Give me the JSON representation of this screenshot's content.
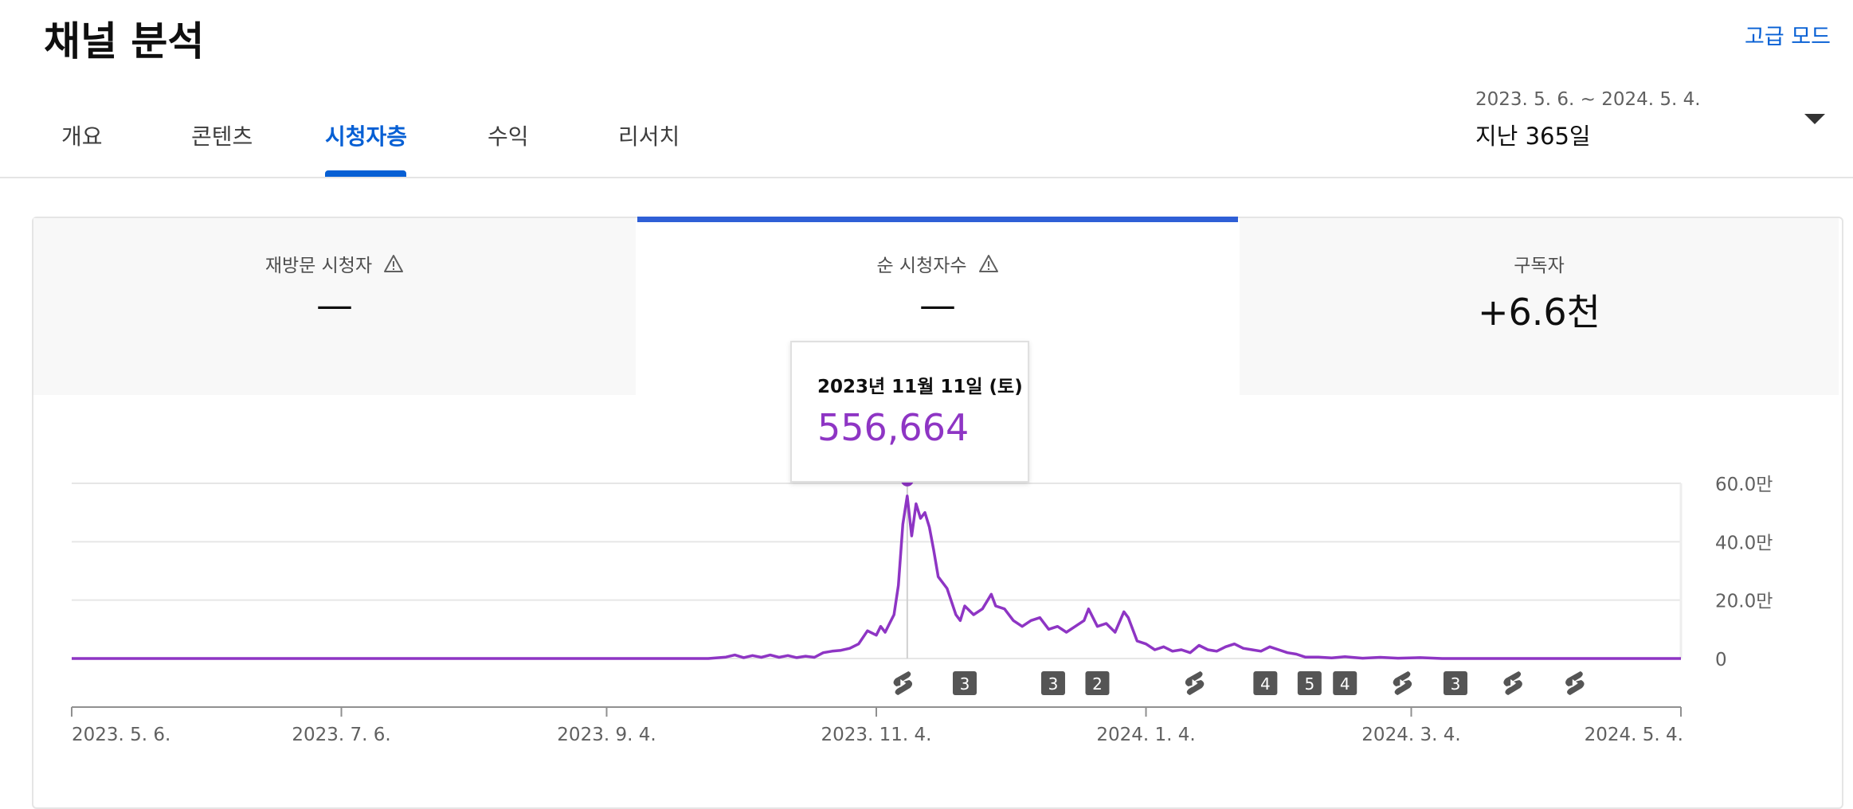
{
  "header": {
    "title": "채널 분석",
    "advanced_mode": "고급 모드"
  },
  "tabs": [
    {
      "label": "개요"
    },
    {
      "label": "콘텐츠"
    },
    {
      "label": "시청자층",
      "active": true
    },
    {
      "label": "수익"
    },
    {
      "label": "리서치"
    }
  ],
  "date_picker": {
    "range": "2023. 5. 6. ~ 2024. 5. 4.",
    "label": "지난 365일"
  },
  "metrics": [
    {
      "label": "재방문 시청자",
      "value": "—",
      "warning": true
    },
    {
      "label": "순 시청자수",
      "value": "—",
      "warning": true,
      "selected": true
    },
    {
      "label": "구독자",
      "value": "+6.6천"
    }
  ],
  "tooltip": {
    "date": "2023년 11월 11일 (토)",
    "value": "556,664"
  },
  "colors": {
    "accent": "#065fd4",
    "series": "#8e35c4",
    "selected_bar": "#2f5fd6"
  },
  "chart_data": {
    "type": "line",
    "series": [
      {
        "points": [
          [
            "2023-05-06",
            0
          ],
          [
            "2023-09-01",
            0
          ],
          [
            "2023-09-27",
            0
          ],
          [
            "2023-10-01",
            5000
          ],
          [
            "2023-10-03",
            12000
          ],
          [
            "2023-10-05",
            3000
          ],
          [
            "2023-10-07",
            10000
          ],
          [
            "2023-10-09",
            4000
          ],
          [
            "2023-10-11",
            12000
          ],
          [
            "2023-10-13",
            4000
          ],
          [
            "2023-10-15",
            10000
          ],
          [
            "2023-10-17",
            3000
          ],
          [
            "2023-10-19",
            8000
          ],
          [
            "2023-10-21",
            4000
          ],
          [
            "2023-10-23",
            20000
          ],
          [
            "2023-10-25",
            25000
          ],
          [
            "2023-10-27",
            28000
          ],
          [
            "2023-10-29",
            35000
          ],
          [
            "2023-10-31",
            50000
          ],
          [
            "2023-11-02",
            95000
          ],
          [
            "2023-11-04",
            80000
          ],
          [
            "2023-11-05",
            110000
          ],
          [
            "2023-11-06",
            90000
          ],
          [
            "2023-11-07",
            120000
          ],
          [
            "2023-11-08",
            150000
          ],
          [
            "2023-11-09",
            250000
          ],
          [
            "2023-11-10",
            460000
          ],
          [
            "2023-11-11",
            556664
          ],
          [
            "2023-11-12",
            420000
          ],
          [
            "2023-11-13",
            530000
          ],
          [
            "2023-11-14",
            480000
          ],
          [
            "2023-11-15",
            500000
          ],
          [
            "2023-11-16",
            450000
          ],
          [
            "2023-11-17",
            370000
          ],
          [
            "2023-11-18",
            280000
          ],
          [
            "2023-11-20",
            240000
          ],
          [
            "2023-11-22",
            150000
          ],
          [
            "2023-11-23",
            130000
          ],
          [
            "2023-11-24",
            180000
          ],
          [
            "2023-11-26",
            150000
          ],
          [
            "2023-11-28",
            170000
          ],
          [
            "2023-11-30",
            220000
          ],
          [
            "2023-12-01",
            180000
          ],
          [
            "2023-12-03",
            170000
          ],
          [
            "2023-12-05",
            130000
          ],
          [
            "2023-12-07",
            110000
          ],
          [
            "2023-12-09",
            130000
          ],
          [
            "2023-12-11",
            140000
          ],
          [
            "2023-12-13",
            100000
          ],
          [
            "2023-12-15",
            110000
          ],
          [
            "2023-12-17",
            90000
          ],
          [
            "2023-12-19",
            110000
          ],
          [
            "2023-12-21",
            130000
          ],
          [
            "2023-12-22",
            170000
          ],
          [
            "2023-12-24",
            110000
          ],
          [
            "2023-12-26",
            120000
          ],
          [
            "2023-12-28",
            90000
          ],
          [
            "2023-12-30",
            160000
          ],
          [
            "2023-12-31",
            140000
          ],
          [
            "2024-01-02",
            60000
          ],
          [
            "2024-01-04",
            50000
          ],
          [
            "2024-01-06",
            30000
          ],
          [
            "2024-01-08",
            40000
          ],
          [
            "2024-01-10",
            25000
          ],
          [
            "2024-01-12",
            30000
          ],
          [
            "2024-01-14",
            20000
          ],
          [
            "2024-01-16",
            45000
          ],
          [
            "2024-01-18",
            30000
          ],
          [
            "2024-01-20",
            25000
          ],
          [
            "2024-01-22",
            40000
          ],
          [
            "2024-01-24",
            50000
          ],
          [
            "2024-01-26",
            35000
          ],
          [
            "2024-01-28",
            30000
          ],
          [
            "2024-01-30",
            25000
          ],
          [
            "2024-02-01",
            40000
          ],
          [
            "2024-02-03",
            30000
          ],
          [
            "2024-02-05",
            20000
          ],
          [
            "2024-02-07",
            15000
          ],
          [
            "2024-02-09",
            5000
          ],
          [
            "2024-02-12",
            5000
          ],
          [
            "2024-02-15",
            2000
          ],
          [
            "2024-02-18",
            6000
          ],
          [
            "2024-02-22",
            1000
          ],
          [
            "2024-02-26",
            4000
          ],
          [
            "2024-03-01",
            1000
          ],
          [
            "2024-03-06",
            3000
          ],
          [
            "2024-03-11",
            0
          ],
          [
            "2024-05-04",
            0
          ]
        ]
      }
    ],
    "x_ticks": [
      "2023. 5. 6.",
      "2023. 7. 6.",
      "2023. 9. 4.",
      "2023. 11. 4.",
      "2024. 1. 4.",
      "2024. 3. 4.",
      "2024. 5. 4."
    ],
    "y_ticks": [
      "60.0만",
      "40.0만",
      "20.0만",
      "0"
    ],
    "ylim": [
      0,
      600000
    ],
    "grid": true,
    "highlight": {
      "x": "2023-11-11",
      "y": 556664
    },
    "markers": [
      {
        "date": "2023-11-10",
        "type": "shorts-icon"
      },
      {
        "date": "2023-11-24",
        "type": "count",
        "label": "3"
      },
      {
        "date": "2023-12-14",
        "type": "count",
        "label": "3"
      },
      {
        "date": "2023-12-24",
        "type": "count",
        "label": "2"
      },
      {
        "date": "2024-01-15",
        "type": "shorts-icon"
      },
      {
        "date": "2024-01-31",
        "type": "count",
        "label": "4"
      },
      {
        "date": "2024-02-10",
        "type": "count",
        "label": "5"
      },
      {
        "date": "2024-02-18",
        "type": "count",
        "label": "4"
      },
      {
        "date": "2024-03-02",
        "type": "shorts-icon"
      },
      {
        "date": "2024-03-14",
        "type": "count",
        "label": "3"
      },
      {
        "date": "2024-03-27",
        "type": "shorts-icon"
      },
      {
        "date": "2024-04-10",
        "type": "shorts-icon"
      }
    ]
  }
}
